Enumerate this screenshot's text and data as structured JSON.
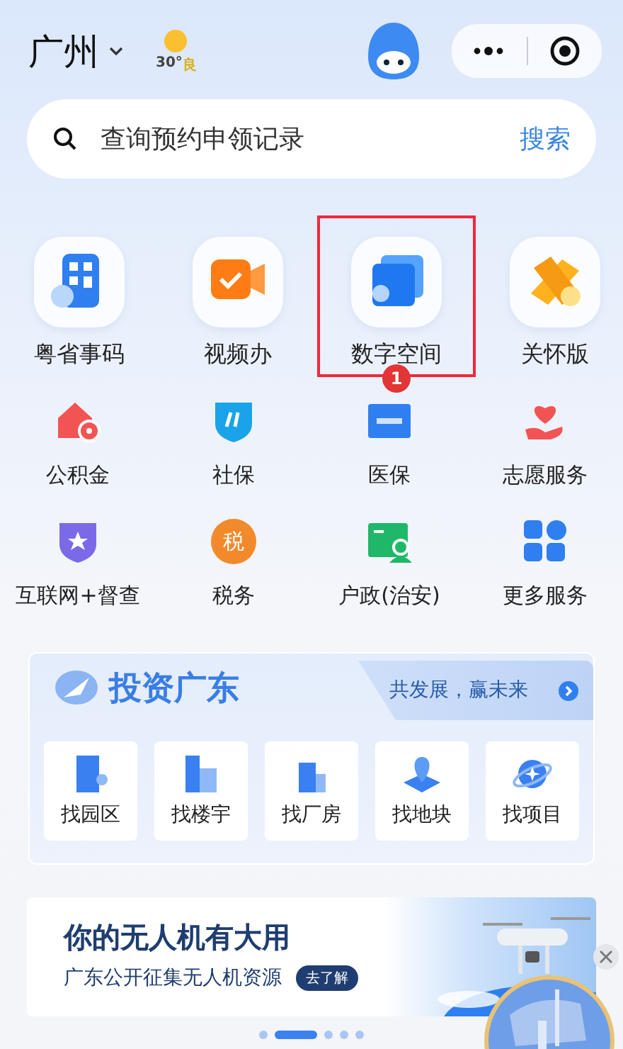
{
  "header": {
    "city": "广州",
    "temperature": "30°",
    "air_quality": "良"
  },
  "search": {
    "placeholder": "查询预约申领记录",
    "button": "搜索"
  },
  "featured": [
    {
      "label": "粤省事码",
      "highlighted": false
    },
    {
      "label": "视频办",
      "highlighted": false
    },
    {
      "label": "数字空间",
      "highlighted": true,
      "badge": "1"
    },
    {
      "label": "关怀版",
      "highlighted": false
    }
  ],
  "services": [
    {
      "label": "公积金"
    },
    {
      "label": "社保"
    },
    {
      "label": "医保"
    },
    {
      "label": "志愿服务"
    },
    {
      "label": "互联网+督查"
    },
    {
      "label": "税务",
      "icon_text": "税"
    },
    {
      "label": "户政(治安)"
    },
    {
      "label": "更多服务"
    }
  ],
  "invest": {
    "title": "投资广东",
    "slogan": "共发展，赢未来",
    "items": [
      {
        "label": "找园区"
      },
      {
        "label": "找楼宇"
      },
      {
        "label": "找厂房"
      },
      {
        "label": "找地块"
      },
      {
        "label": "找项目"
      }
    ]
  },
  "banner": {
    "title": "你的无人机有大用",
    "subtitle": "广东公开征集无人机资源",
    "link": "去了解"
  },
  "carousel": [
    {
      "selected": false
    },
    {
      "selected": true
    },
    {
      "selected": false
    },
    {
      "selected": false
    },
    {
      "selected": false
    }
  ]
}
